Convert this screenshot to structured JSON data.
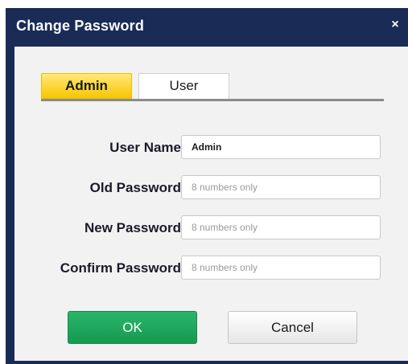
{
  "dialog": {
    "title": "Change Password",
    "close_icon": "close-icon",
    "close_glyph": "×"
  },
  "tabs": [
    {
      "label": "Admin",
      "selected": true
    },
    {
      "label": "User",
      "selected": false
    }
  ],
  "form": {
    "user_name": {
      "label": "User Name",
      "value": "Admin"
    },
    "old_password": {
      "label": "Old Password",
      "placeholder": "8 numbers only"
    },
    "new_password": {
      "label": "New Password",
      "placeholder": "8 numbers only"
    },
    "confirm_password": {
      "label": "Confirm Password",
      "placeholder": "8 numbers only"
    }
  },
  "buttons": {
    "ok": "OK",
    "cancel": "Cancel"
  },
  "colors": {
    "titlebar": "#1a2b56",
    "tab_active": "#f7c600",
    "ok_button": "#1fa85c"
  }
}
